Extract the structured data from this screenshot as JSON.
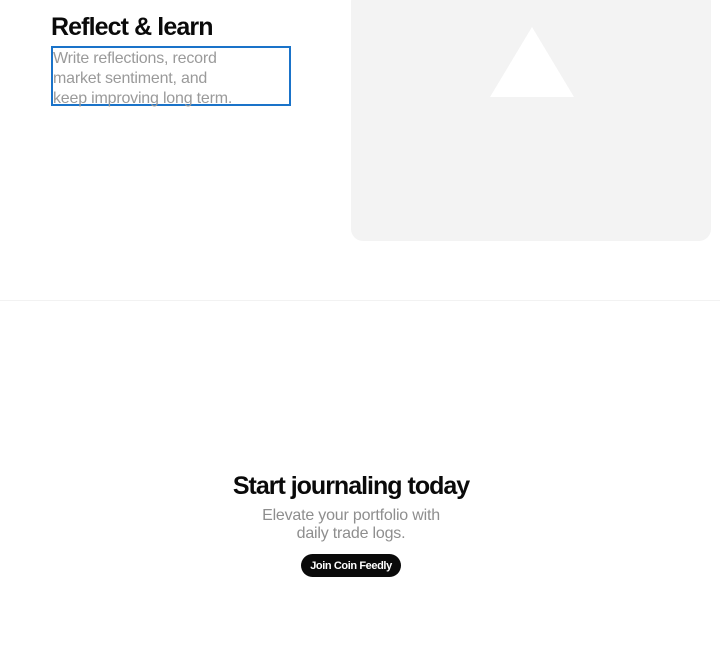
{
  "feature": {
    "title": "Reflect & learn",
    "description_lines": [
      "Write reflections, record",
      "market sentiment, and",
      "keep improving long term."
    ],
    "media_icon": "triangle-placeholder-icon"
  },
  "cta": {
    "title": "Start journaling today",
    "subtitle_lines": [
      "Elevate your portfolio with",
      "daily trade logs."
    ],
    "button_label": "Join Coin Feedly"
  },
  "colors": {
    "text_primary": "#0a0a0a",
    "text_muted": "#9a9a9a",
    "card_bg": "#f3f3f3",
    "selection_outline": "#1a73c9",
    "button_bg": "#0a0a0a",
    "button_text": "#ffffff"
  }
}
